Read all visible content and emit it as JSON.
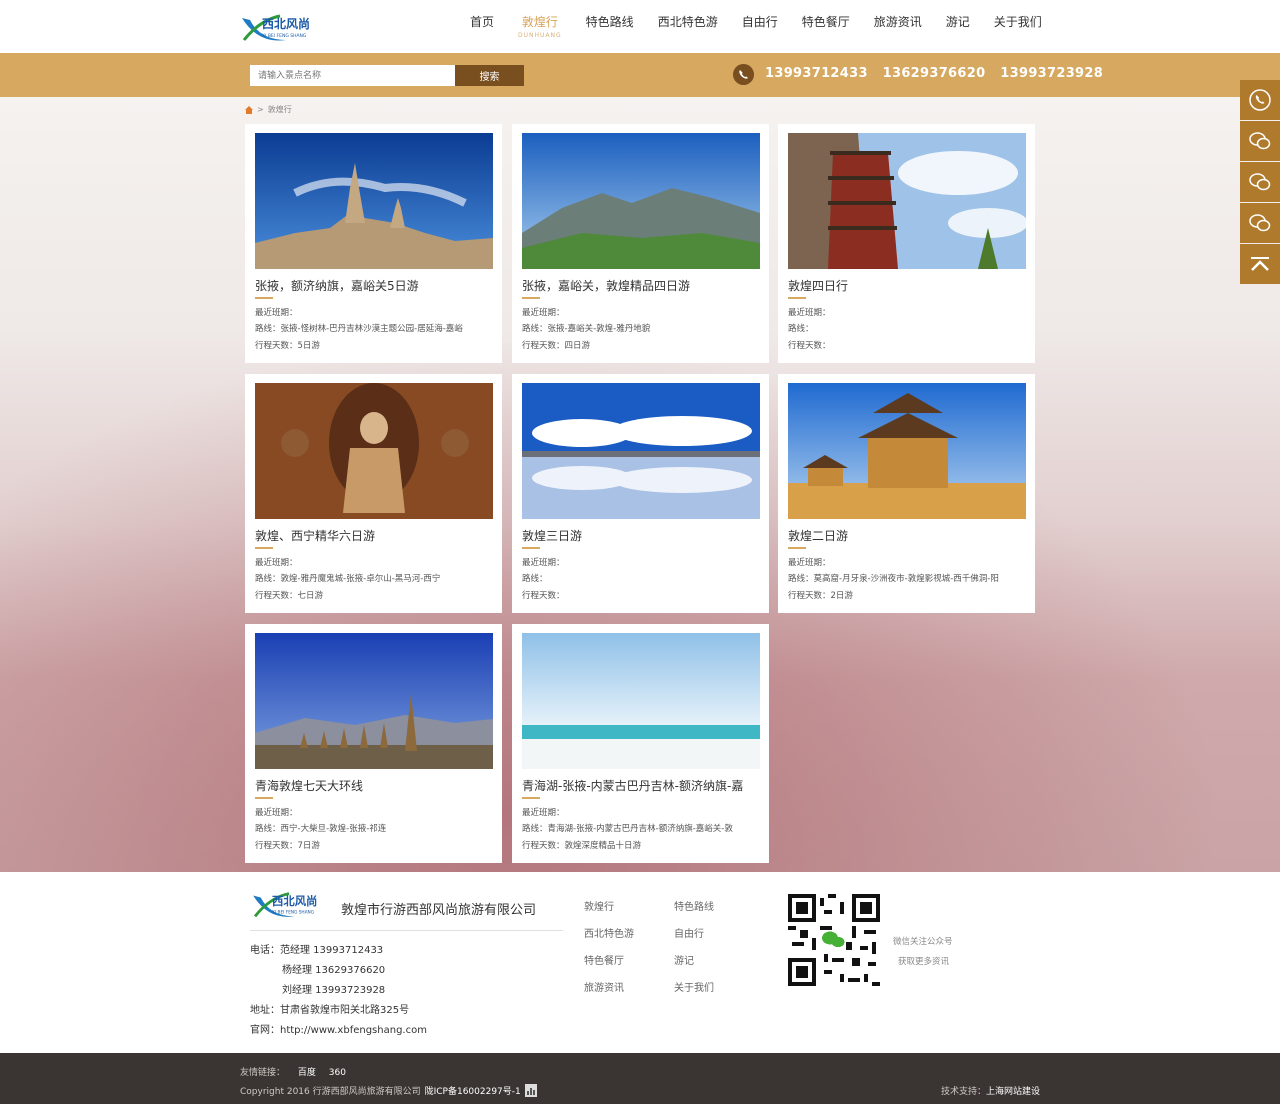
{
  "brand": {
    "logo_text": "西北风尚",
    "logo_sub": "XI BEI FENG SHANG"
  },
  "nav": [
    {
      "label": "首页",
      "sub": ""
    },
    {
      "label": "敦煌行",
      "sub": "DUNHUANG"
    },
    {
      "label": "特色路线",
      "sub": ""
    },
    {
      "label": "西北特色游",
      "sub": ""
    },
    {
      "label": "自由行",
      "sub": ""
    },
    {
      "label": "特色餐厅",
      "sub": ""
    },
    {
      "label": "旅游资讯",
      "sub": ""
    },
    {
      "label": "游记",
      "sub": ""
    },
    {
      "label": "关于我们",
      "sub": ""
    }
  ],
  "search": {
    "placeholder": "请输入景点名称",
    "button": "搜索"
  },
  "phones": [
    "13993712433",
    "13629376620",
    "13993723928"
  ],
  "breadcrumb": {
    "sep": ">",
    "current": "敦煌行"
  },
  "cards": [
    {
      "title": "张掖，额济纳旗，嘉峪关5日游",
      "recent": "最近班期：",
      "route": "路线：张掖-怪树林-巴丹吉林沙漠主题公园-居延海-嘉峪",
      "days": "行程天数：5日游"
    },
    {
      "title": "张掖，嘉峪关，敦煌精品四日游",
      "recent": "最近班期：",
      "route": "路线：张掖-嘉峪关-敦煌-雅丹地貌",
      "days": "行程天数：四日游"
    },
    {
      "title": "敦煌四日行",
      "recent": "最近班期：",
      "route": "路线：",
      "days": "行程天数："
    },
    {
      "title": "敦煌、西宁精华六日游",
      "recent": "最近班期：",
      "route": "路线：敦煌-雅丹魔鬼城-张掖-卓尔山-黑马河-西宁",
      "days": "行程天数：七日游"
    },
    {
      "title": "敦煌三日游",
      "recent": "最近班期：",
      "route": "路线：",
      "days": "行程天数："
    },
    {
      "title": "敦煌二日游",
      "recent": "最近班期：",
      "route": "路线：莫高窟-月牙泉-沙洲夜市-敦煌影视城-西千佛洞-阳",
      "days": "行程天数：2日游"
    },
    {
      "title": "青海敦煌七天大环线",
      "recent": "最近班期：",
      "route": "路线：西宁-大柴旦-敦煌-张掖-祁连",
      "days": "行程天数：7日游"
    },
    {
      "title": "青海湖-张掖-内蒙古巴丹吉林-额济纳旗-嘉",
      "recent": "最近班期：",
      "route": "路线：青海湖-张掖-内蒙古巴丹吉林-额济纳旗-嘉峪关-敦",
      "days": "行程天数：敦煌深度精品十日游"
    }
  ],
  "sidebar_icons": [
    "phone-icon",
    "wechat-icon",
    "wechat-icon",
    "wechat-icon",
    "back-to-top-icon"
  ],
  "footer": {
    "company": "敦煌市行游西部风尚旅游有限公司",
    "contacts": [
      "电话：范经理 13993712433",
      "杨经理 13629376620",
      "刘经理 13993723928",
      "地址：甘肃省敦煌市阳关北路325号",
      "官网：http://www.xbfengshang.com"
    ],
    "links_col1": [
      "敦煌行",
      "西北特色游",
      "特色餐厅",
      "旅游资讯"
    ],
    "links_col2": [
      "特色路线",
      "自由行",
      "游记",
      "关于我们"
    ],
    "qr_text": [
      "微信关注公众号",
      "获取更多资讯"
    ]
  },
  "bottom": {
    "friend_label": "友情链接：",
    "friends": [
      "百度",
      "360"
    ],
    "copyright": "Copyright 2016 行游西部风尚旅游有限公司",
    "icp": "陇ICP备16002297号-1",
    "support_label": "技术支持：",
    "support_link": "上海网站建设"
  },
  "colors": {
    "gold": "#d6a860",
    "brown": "#7a4f1f",
    "sidebar": "#b07a2c",
    "footer_dark": "#3a3533"
  }
}
